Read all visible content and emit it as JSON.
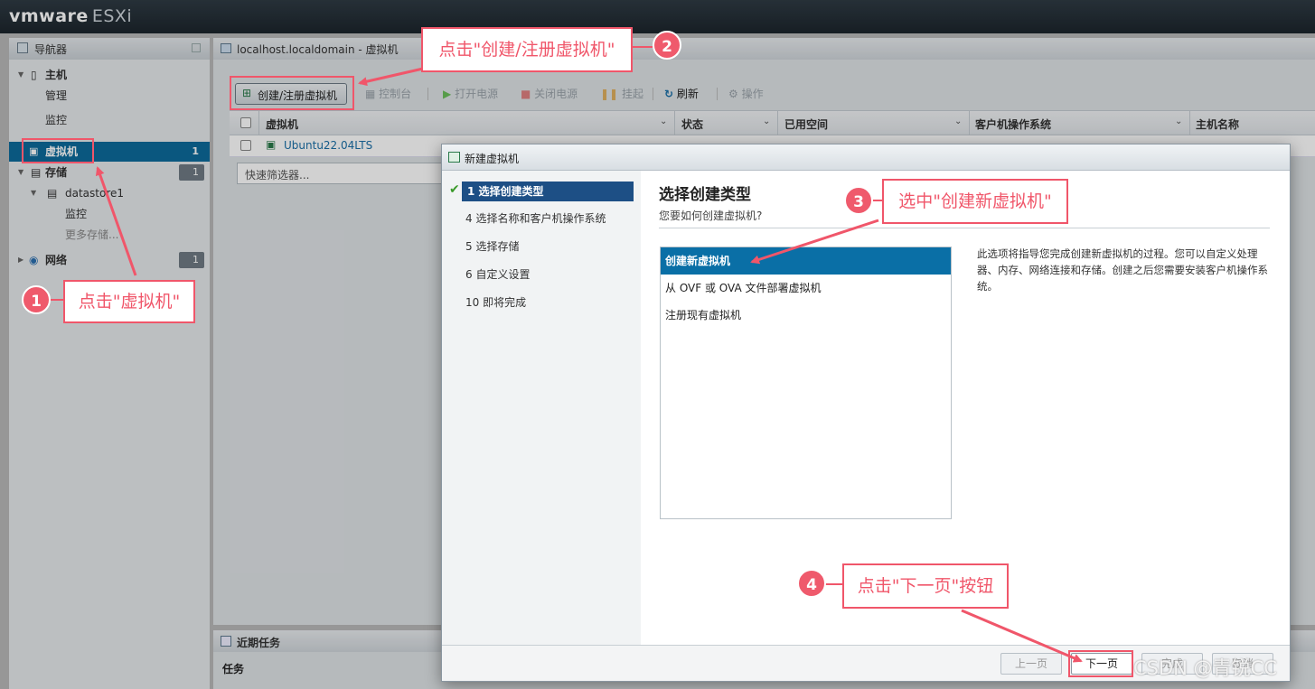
{
  "app": {
    "brand": "vmware",
    "product": "ESXi"
  },
  "navigator": {
    "title": "导航器",
    "items": [
      {
        "label": "主机"
      },
      {
        "label": "管理"
      },
      {
        "label": "监控"
      },
      {
        "label": "虚拟机",
        "count": "1"
      },
      {
        "label": "存储",
        "count": "1"
      },
      {
        "label": "datastore1"
      },
      {
        "label": "监控"
      },
      {
        "label": "更多存储..."
      },
      {
        "label": "网络",
        "count": "1"
      }
    ]
  },
  "main": {
    "title": "localhost.localdomain - 虚拟机",
    "toolbar": {
      "create": "创建/注册虚拟机",
      "console": "控制台",
      "power_on": "打开电源",
      "power_off": "关闭电源",
      "suspend": "挂起",
      "refresh": "刷新",
      "actions": "操作"
    },
    "columns": [
      "虚拟机",
      "状态",
      "已用空间",
      "客户机操作系统",
      "主机名称"
    ],
    "rows": [
      {
        "name": "Ubuntu22.04LTS"
      }
    ],
    "filter_placeholder": "快速筛选器..."
  },
  "recent_tasks": {
    "title": "近期任务",
    "col_task": "任务"
  },
  "dialog": {
    "title": "新建虚拟机",
    "steps": [
      {
        "label": "1 选择创建类型"
      },
      {
        "label": "4 选择名称和客户机操作系统"
      },
      {
        "label": "5 选择存储"
      },
      {
        "label": "6 自定义设置"
      },
      {
        "label": "10 即将完成"
      }
    ],
    "heading": "选择创建类型",
    "subheading": "您要如何创建虚拟机?",
    "options": [
      {
        "label": "创建新虚拟机"
      },
      {
        "label": "从 OVF 或 OVA 文件部署虚拟机"
      },
      {
        "label": "注册现有虚拟机"
      }
    ],
    "description": "此选项将指导您完成创建新虚拟机的过程。您可以自定义处理器、内存、网络连接和存储。创建之后您需要安装客户机操作系统。",
    "buttons": {
      "prev": "上一页",
      "next": "下一页",
      "finish": "完成",
      "cancel": "取消"
    }
  },
  "annotations": {
    "a1": {
      "num": "1",
      "text": "点击\"虚拟机\""
    },
    "a2": {
      "num": "2",
      "text": "点击\"创建/注册虚拟机\""
    },
    "a3": {
      "num": "3",
      "text": "选中\"创建新虚拟机\""
    },
    "a4": {
      "num": "4",
      "text": "点击\"下一页\"按钮"
    }
  },
  "watermark": "CSDN @青锐CC",
  "colors": {
    "annotation": "#f0566a",
    "selection": "#0a6fa6",
    "step_current": "#1d4f85"
  }
}
